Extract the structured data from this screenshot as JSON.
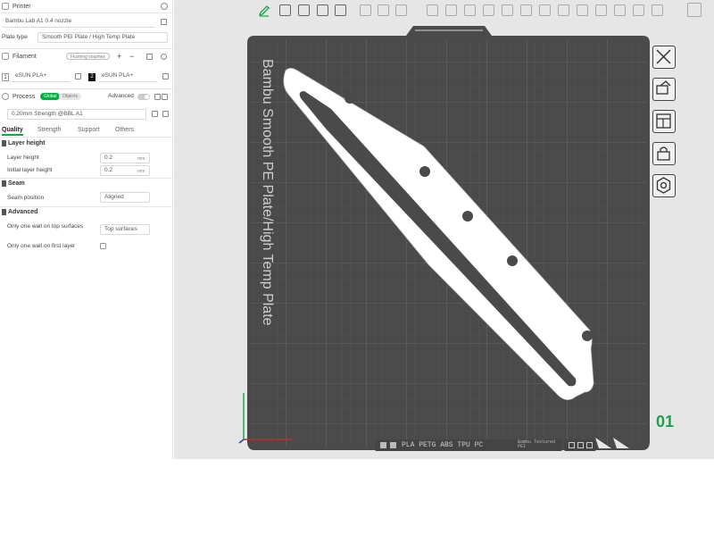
{
  "printer": {
    "section_title": "Printer",
    "name": "Bambu Lab A1 0.4 nozzle",
    "plate_type_label": "Plate type",
    "plate_type_value": "Smooth PEI Plate / High Temp Plate"
  },
  "filament": {
    "section_title": "Filament",
    "badge": "Flushing volumes",
    "slots": [
      {
        "num": "1",
        "name": "eSUN PLA+"
      },
      {
        "num": "2",
        "name": "eSUN PLA+"
      }
    ]
  },
  "process": {
    "section_title": "Process",
    "toggle_global": "Global",
    "toggle_objects": "Objects",
    "advanced_label": "Advanced",
    "preset": "0.20mm Strength @BBL A1",
    "tabs": [
      "Quality",
      "Strength",
      "Support",
      "Others"
    ],
    "active_tab": "Quality"
  },
  "quality": {
    "layer_height_group": "Layer height",
    "layer_height_label": "Layer height",
    "layer_height_value": "0.2",
    "layer_height_unit": "mm",
    "initial_layer_label": "Initial layer height",
    "initial_layer_value": "0.2",
    "initial_layer_unit": "mm",
    "seam_group": "Seam",
    "seam_position_label": "Seam position",
    "seam_position_value": "Aligned",
    "advanced_group": "Advanced",
    "one_wall_top_label": "Only one wall on top surfaces",
    "one_wall_top_value": "Top surfaces",
    "one_wall_first_label": "Only one wall on first layer"
  },
  "plate": {
    "plate_text": "Bambu Smooth PE Plate/High Temp Plate",
    "plate_number": "01",
    "bottom_text": "PLA PETG ABS TPU PC",
    "bottom_sub": "Bambu Textured PEI"
  },
  "colors": {
    "accent": "#00ae42",
    "plate_dark": "#4a4a4a",
    "plate_number": "#1aa34a"
  },
  "icons": {
    "toolbar": [
      "pencil-icon",
      "cube-icon",
      "grid-icon",
      "layers-icon",
      "copy-icon",
      "paste-icon",
      "list-icon",
      "move-icon",
      "rotate-icon",
      "scale-icon",
      "cut-icon",
      "support-icon",
      "seam-icon",
      "measure-icon",
      "text-icon",
      "color-icon",
      "assembly-icon"
    ],
    "side": [
      "close-icon",
      "orient-icon",
      "arrange-icon",
      "lock-icon",
      "settings-icon"
    ]
  }
}
